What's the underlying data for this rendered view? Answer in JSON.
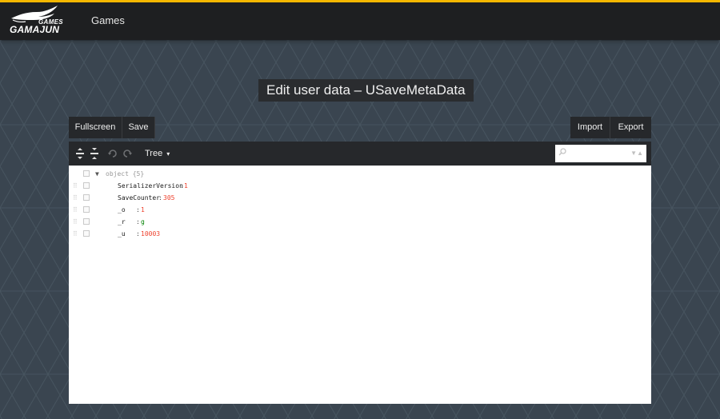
{
  "header": {
    "logo_word_top": "GAMES",
    "logo_word": "GAMAJUN",
    "nav_games": "Games",
    "accent_color": "#f5b700"
  },
  "page": {
    "title": "Edit user data – USaveMetaData"
  },
  "toolbar": {
    "fullscreen_label": "Fullscreen",
    "save_label": "Save",
    "import_label": "Import",
    "export_label": "Export"
  },
  "editor": {
    "mode_label": "Tree",
    "mode_caret": "▾",
    "expand_all_icon": "expand-all-icon",
    "collapse_all_icon": "collapse-all-icon",
    "undo_icon": "undo-icon",
    "redo_icon": "redo-icon",
    "search_value": "",
    "root_expander": "▼",
    "root_label": "object {5}",
    "fields": [
      {
        "key": "SerializerVersion",
        "value": "1",
        "type": "number"
      },
      {
        "key": "SaveCounter",
        "value": "305",
        "type": "number"
      },
      {
        "key": "_o",
        "value": "1",
        "type": "number"
      },
      {
        "key": "_r",
        "value": "g",
        "type": "string"
      },
      {
        "key": "_u",
        "value": "10003",
        "type": "number"
      }
    ],
    "number_color": "#ee422e",
    "string_color": "#008000"
  }
}
